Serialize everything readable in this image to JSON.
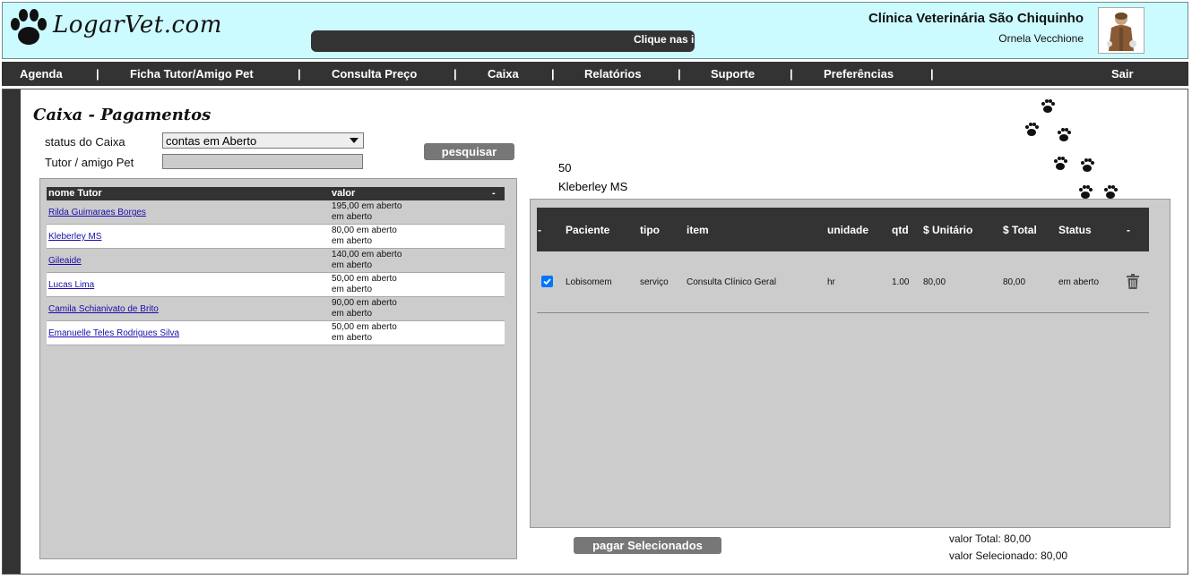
{
  "header": {
    "logo_text": "LogarVet.com",
    "marquee_text": "Clique nas i",
    "clinic_name": "Clínica Veterinária São Chiquinho",
    "user_name": "Ornela Vecchione"
  },
  "nav": {
    "items": [
      "Agenda",
      "Ficha Tutor/Amigo Pet",
      "Consulta Preço",
      "Caixa",
      "Relatórios",
      "Suporte",
      "Preferências",
      "Sair"
    ],
    "separator": "|"
  },
  "page": {
    "title": "Caixa - Pagamentos",
    "status_label": "status do Caixa",
    "status_value": "contas em Aberto",
    "tutor_label": "Tutor / amigo Pet",
    "tutor_value": "",
    "search_button": "pesquisar"
  },
  "tutor_list": {
    "col_name": "nome Tutor",
    "col_value": "valor",
    "col_extra": "-",
    "rows": [
      {
        "name": "Rilda Guimaraes Borges",
        "value": "195,00 em aberto",
        "status": "em aberto"
      },
      {
        "name": "Kleberley MS",
        "value": "80,00 em aberto",
        "status": "em aberto"
      },
      {
        "name": "Gileaide",
        "value": "140,00 em aberto",
        "status": "em aberto"
      },
      {
        "name": "Lucas Lima",
        "value": "50,00 em aberto",
        "status": "em aberto"
      },
      {
        "name": "Camila Schianivato de Brito",
        "value": "90,00 em aberto",
        "status": "em aberto"
      },
      {
        "name": "Emanuelle Teles Rodrigues Silva",
        "value": "50,00 em aberto",
        "status": "em aberto"
      }
    ]
  },
  "selected": {
    "code": "50",
    "name": "Kleberley MS"
  },
  "items_table": {
    "columns": [
      "-",
      "Paciente",
      "tipo",
      "item",
      "unidade",
      "qtd",
      "$ Unitário",
      "$ Total",
      "Status",
      "-"
    ],
    "rows": [
      {
        "checked": true,
        "paciente": "Lobisomem",
        "tipo": "serviço",
        "item": "Consulta Clínico Geral",
        "unidade": "hr",
        "qtd": "1.00",
        "unitario": "80,00",
        "total": "80,00",
        "status": "em aberto"
      }
    ]
  },
  "footer": {
    "pay_button": "pagar Selecionados",
    "total_label": "valor Total: 80,00",
    "selected_label": "valor Selecionado: 80,00"
  }
}
